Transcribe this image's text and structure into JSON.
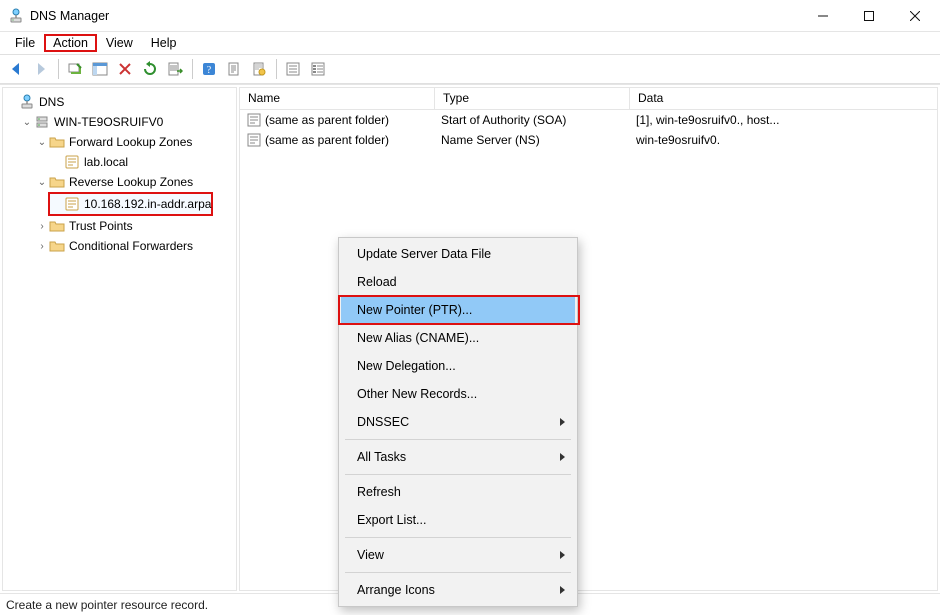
{
  "titlebar": {
    "title": "DNS Manager"
  },
  "menubar": {
    "file": "File",
    "action": "Action",
    "view": "View",
    "help": "Help"
  },
  "tree": {
    "root": "DNS",
    "server": "WIN-TE9OSRUIFV0",
    "flz": "Forward Lookup Zones",
    "flz_child": "lab.local",
    "rlz": "Reverse Lookup Zones",
    "rlz_child": "10.168.192.in-addr.arpa",
    "tp": "Trust Points",
    "cf": "Conditional Forwarders"
  },
  "list": {
    "columns": {
      "name": "Name",
      "type": "Type",
      "data": "Data"
    },
    "rows": [
      {
        "name": "(same as parent folder)",
        "type": "Start of Authority (SOA)",
        "data": "[1], win-te9osruifv0., host..."
      },
      {
        "name": "(same as parent folder)",
        "type": "Name Server (NS)",
        "data": "win-te9osruifv0."
      }
    ]
  },
  "contextmenu": {
    "update": "Update Server Data File",
    "reload": "Reload",
    "newptr": "New Pointer (PTR)...",
    "newcname": "New Alias (CNAME)...",
    "newdeleg": "New Delegation...",
    "other": "Other New Records...",
    "dnssec": "DNSSEC",
    "alltasks": "All Tasks",
    "refresh": "Refresh",
    "export": "Export List...",
    "view": "View",
    "arrange": "Arrange Icons"
  },
  "statusbar": {
    "text": "Create a new pointer resource record."
  }
}
